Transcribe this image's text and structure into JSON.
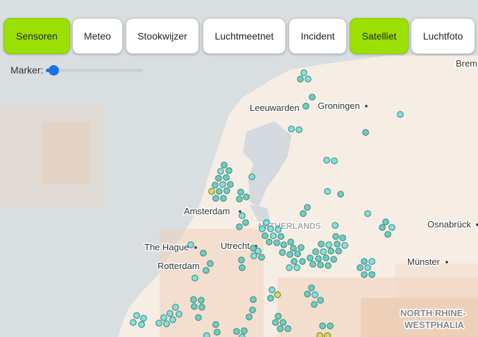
{
  "toolbar": {
    "tabs": [
      {
        "label": "Sensoren",
        "active": true
      },
      {
        "label": "Meteo",
        "active": false
      },
      {
        "label": "Stookwijzer",
        "active": false
      },
      {
        "label": "Luchtmeetnet",
        "active": false
      },
      {
        "label": "Incident",
        "active": false
      },
      {
        "label": "Satelliet",
        "active": true
      },
      {
        "label": "Luchtfoto",
        "active": false
      }
    ]
  },
  "marker_control": {
    "label": "Marker:",
    "value": 0.05
  },
  "map": {
    "labels": {
      "bremen": "Brem",
      "leeuwarden": "Leeuwarden",
      "groningen": "Groningen",
      "amsterdam": "Amsterdam",
      "netherlands": "NETHERLANDS",
      "osnabruck": "Osnabrück",
      "the_hague": "The Hague",
      "utrecht": "Utrecht",
      "rotterdam": "Rotterdam",
      "munster": "Münster",
      "nrw_line1": "NORTH RHINE-",
      "nrw_line2": "WESTPHALIA"
    },
    "colors": {
      "sea": "#d9dee1",
      "land": "#f6ede4",
      "sensor_teal": "#6ccfbf",
      "sensor_cyan": "#7de3e0",
      "sensor_yellow": "#e8d93a",
      "active_tab": "#9be000"
    }
  }
}
